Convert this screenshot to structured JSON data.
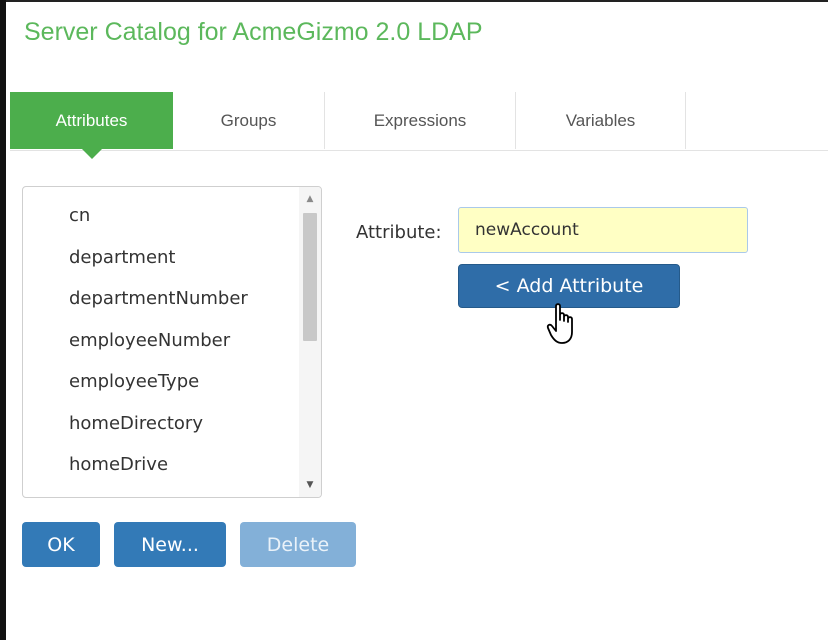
{
  "window": {
    "title": "Server Catalog for AcmeGizmo 2.0 LDAP"
  },
  "tabs": [
    {
      "label": "Attributes",
      "active": true
    },
    {
      "label": "Groups",
      "active": false
    },
    {
      "label": "Expressions",
      "active": false
    },
    {
      "label": "Variables",
      "active": false
    }
  ],
  "attribute_list": {
    "items": [
      "cn",
      "department",
      "departmentNumber",
      "employeeNumber",
      "employeeType",
      "homeDirectory",
      "homeDrive"
    ]
  },
  "attribute_form": {
    "label": "Attribute:",
    "value": "newAccount",
    "add_button": "< Add Attribute"
  },
  "footer": {
    "ok": "OK",
    "new": "New...",
    "delete": "Delete"
  },
  "colors": {
    "title_green": "#5cb85c",
    "tab_active": "#4cae4c",
    "button_blue": "#337ab7",
    "input_highlight": "#ffffc4"
  }
}
